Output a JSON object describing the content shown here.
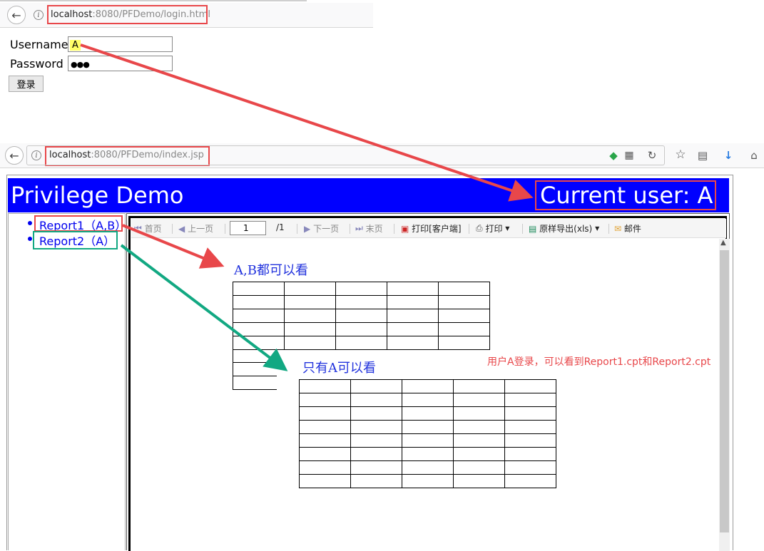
{
  "login_browser": {
    "url_host": "localhost",
    "url_path": ":8080/PFDemo/login.html"
  },
  "login_form": {
    "username_label": "Username",
    "username_value": "A",
    "password_label": "Password",
    "password_value": "●●●",
    "submit_label": "登录"
  },
  "index_browser": {
    "url_host": "localhost",
    "url_path": ":8080/PFDemo/index.jsp"
  },
  "page": {
    "title": "Privilege Demo",
    "current_user": "Current user: A"
  },
  "sidebar": {
    "items": [
      {
        "label": "Report1（A,B）"
      },
      {
        "label": "Report2（A）"
      }
    ]
  },
  "report_toolbar": {
    "first": "首页",
    "prev": "上一页",
    "page_input": "1",
    "page_total": "/1",
    "next": "下一页",
    "last": "末页",
    "print_client": "打印[客户端]",
    "print": "打印",
    "export": "原样导出(xls)",
    "mail": "邮件"
  },
  "annotations": {
    "report1_note": "A,B都可以看",
    "report2_note": "只有A可以看",
    "summary": "用户A登录，可以看到Report1.cpt和Report2.cpt"
  },
  "colors": {
    "header_bg": "#0000ff",
    "red_highlight": "#e8474a",
    "green_highlight": "#12a882",
    "link": "#0000ee"
  }
}
